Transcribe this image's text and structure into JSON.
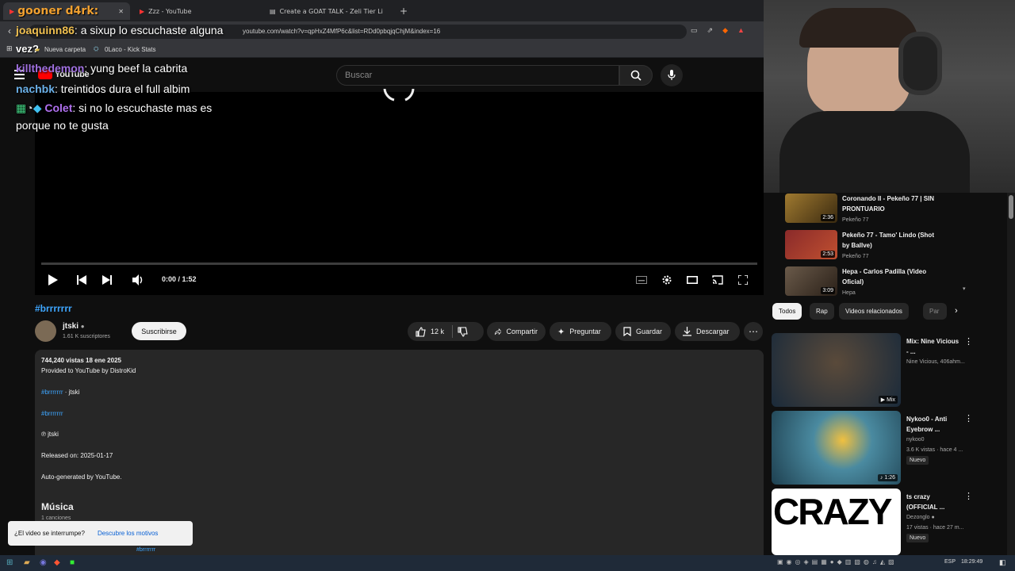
{
  "browser": {
    "tabs": [
      {
        "label": "gooner d4rk:",
        "active": true
      },
      {
        "label": "Zzz - YouTube",
        "active": false
      },
      {
        "label": "Create a GOAT TALK - Zeli Tier List -",
        "active": false
      }
    ],
    "url": "youtube.com/watch?v=qpHxZ4MfP6c&list=RDd0pbqjqChjM&index=16",
    "bookmarks": [
      "vez?",
      "Nueva carpeta",
      "0Laco - Kick Stats"
    ]
  },
  "chat_overlay": [
    {
      "user": "joaquinn86",
      "message": "a sixup lo escuchaste alguna",
      "color": "#f0c050"
    },
    {
      "user": "killthedemon",
      "message": "yung beef la cabrita",
      "color": "#a070e0"
    },
    {
      "user": "nachbk",
      "message": "treintidos dura el full albim",
      "color": "#6ab0e8"
    },
    {
      "user": "Colet",
      "message": "si no lo escuchaste mas es",
      "color": "#b070f0"
    },
    {
      "user": "",
      "message": "porque no te gusta",
      "color": "#ffffff"
    }
  ],
  "youtube": {
    "logo": "YouTube",
    "search_placeholder": "Buscar",
    "player": {
      "time": "0:00 / 1:52",
      "progress_fraction": 0.0
    },
    "video": {
      "hashtag": "#brrrrrrr",
      "channel": "jtski",
      "subscribers": "1.61 K suscriptores",
      "subscribe_label": "Suscribirse",
      "likes": "12 k",
      "share_label": "Compartir",
      "ask_label": "Preguntar",
      "save_label": "Guardar",
      "download_label": "Descargar"
    },
    "description": {
      "stats": "744,240 vistas  18 ene 2025",
      "line1": "Provided to YouTube by DistroKid",
      "line2_link": "#brrrrrrr",
      "line2_rest": " · jtski",
      "line3_link": "#brrrrrrr",
      "line4": "℗ jtski",
      "line5": "Released on: 2025-01-17",
      "line6": "Auto-generated by YouTube.",
      "music_heading": "Música",
      "songs_count": "1 canciones",
      "song_link": "#brrrrrrr"
    },
    "toast": {
      "text": "¿El video se interrumpe?",
      "link": "Descubre los motivos"
    },
    "playlist": [
      {
        "title": "Coronando II - Pekeño 77 | SIN PRONTUARIO",
        "channel": "Pekeño 77",
        "duration": "2:36",
        "color": "#8a6a2a"
      },
      {
        "title": "Pekeño 77 - Tamo' Lindo (Shot by Ballve)",
        "channel": "Pekeño 77",
        "duration": "2:53",
        "color": "#6a2a2a"
      },
      {
        "title": "Hepa - Carlos Padilla (Video Oficial)",
        "channel": "Hepa",
        "duration": "3:09",
        "color": "#5a4a3a"
      }
    ],
    "chips": [
      "Todos",
      "Rap",
      "Videos relacionados",
      "Par"
    ],
    "recommendations": [
      {
        "title": "Mix: Nine Vicious - ...",
        "meta1": "Nine Vicious, 406ahm...",
        "meta2": "",
        "badge": "",
        "overlay": "Mix",
        "color": "#2a3a4a"
      },
      {
        "title": "Nykoo0 - Anti Eyebrow ...",
        "meta1": "nykoo0",
        "meta2": "3.6 K vistas · hace 4 ...",
        "badge": "Nuevo",
        "overlay": "1:26",
        "color": "#3a6a7a"
      },
      {
        "title": "ts crazy (OFFICIAL ...",
        "meta1": "Dezonglo",
        "meta2": "17 vistas · hace 27 m...",
        "badge": "Nuevo",
        "overlay": "CRAZY",
        "color": "#ffffff"
      }
    ]
  },
  "taskbar": {
    "lang": "ESP",
    "time": "18:29:49"
  }
}
